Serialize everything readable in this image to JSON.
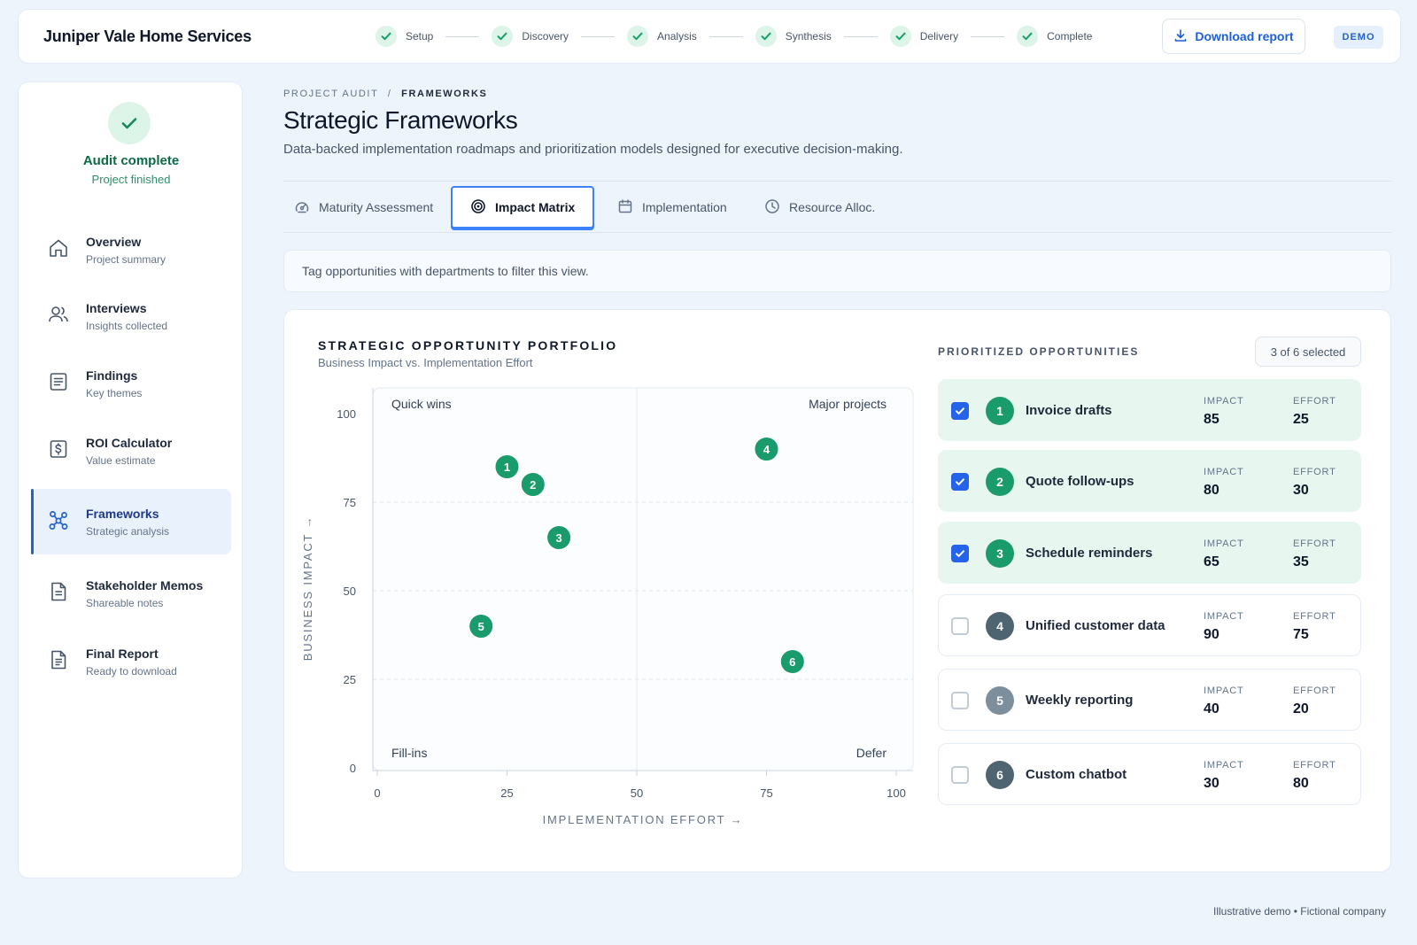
{
  "brand": "Juniper Vale Home Services",
  "steps": [
    {
      "label": "Setup"
    },
    {
      "label": "Discovery"
    },
    {
      "label": "Analysis"
    },
    {
      "label": "Synthesis"
    },
    {
      "label": "Delivery"
    },
    {
      "label": "Complete"
    }
  ],
  "header": {
    "download_label": "Download report",
    "download_icon": "download-icon",
    "demo_badge": "DEMO"
  },
  "sidebar": {
    "status_title": "Audit complete",
    "status_sub": "Project finished",
    "items": [
      {
        "label": "Overview",
        "sub": "Project summary",
        "icon": "home-icon"
      },
      {
        "label": "Interviews",
        "sub": "Insights collected",
        "icon": "users-icon"
      },
      {
        "label": "Findings",
        "sub": "Key themes",
        "icon": "list-icon"
      },
      {
        "label": "ROI Calculator",
        "sub": "Value estimate",
        "icon": "dollar-icon"
      },
      {
        "label": "Frameworks",
        "sub": "Strategic analysis",
        "icon": "network-icon",
        "active": true
      },
      {
        "label": "Stakeholder Memos",
        "sub": "Shareable notes",
        "icon": "document-icon"
      },
      {
        "label": "Final Report",
        "sub": "Ready to download",
        "icon": "report-icon"
      }
    ]
  },
  "page": {
    "breadcrumb_root": "PROJECT AUDIT",
    "breadcrumb_sep": "/",
    "breadcrumb_current": "FRAMEWORKS",
    "title": "Strategic Frameworks",
    "subtitle": "Data-backed implementation roadmaps and prioritization models designed for executive decision-making.",
    "tabs": [
      {
        "label": "Maturity Assessment",
        "icon": "gauge-icon"
      },
      {
        "label": "Impact Matrix",
        "icon": "target-icon",
        "active": true
      },
      {
        "label": "Implementation",
        "icon": "calendar-icon"
      },
      {
        "label": "Resource Alloc.",
        "icon": "clock-icon"
      }
    ],
    "notice": "Tag opportunities with departments to filter this view."
  },
  "chart_data": {
    "type": "scatter",
    "title": "STRATEGIC OPPORTUNITY PORTFOLIO",
    "subtitle": "Business Impact vs. Implementation Effort",
    "xlabel": "IMPLEMENTATION EFFORT →",
    "ylabel": "BUSINESS IMPACT →",
    "xlim": [
      0,
      100
    ],
    "ylim": [
      0,
      100
    ],
    "xticks": [
      0,
      25,
      50,
      75,
      100
    ],
    "yticks": [
      0,
      25,
      50,
      75,
      100
    ],
    "quadrants": {
      "top_left": "Quick wins",
      "top_right": "Major projects",
      "bottom_left": "Fill-ins",
      "bottom_right": "Defer"
    },
    "point_color": "#1a9b6c",
    "points": [
      {
        "id": "1",
        "x": 25,
        "y": 85
      },
      {
        "id": "2",
        "x": 30,
        "y": 80
      },
      {
        "id": "3",
        "x": 35,
        "y": 65
      },
      {
        "id": "4",
        "x": 75,
        "y": 90
      },
      {
        "id": "5",
        "x": 20,
        "y": 40
      },
      {
        "id": "6",
        "x": 80,
        "y": 30
      }
    ]
  },
  "opportunities": {
    "title": "PRIORITIZED OPPORTUNITIES",
    "selected_count": "3 of 6 selected",
    "impact_label": "IMPACT",
    "effort_label": "EFFORT",
    "items": [
      {
        "num": "1",
        "name": "Invoice drafts",
        "impact": "85",
        "effort": "25",
        "checked": true
      },
      {
        "num": "2",
        "name": "Quote follow-ups",
        "impact": "80",
        "effort": "30",
        "checked": true
      },
      {
        "num": "3",
        "name": "Schedule reminders",
        "impact": "65",
        "effort": "35",
        "checked": true
      },
      {
        "num": "4",
        "name": "Unified customer data",
        "impact": "90",
        "effort": "75",
        "checked": false
      },
      {
        "num": "5",
        "name": "Weekly reporting",
        "impact": "40",
        "effort": "20",
        "checked": false
      },
      {
        "num": "6",
        "name": "Custom chatbot",
        "impact": "30",
        "effort": "80",
        "checked": false
      }
    ]
  },
  "footer": "Illustrative demo • Fictional company"
}
